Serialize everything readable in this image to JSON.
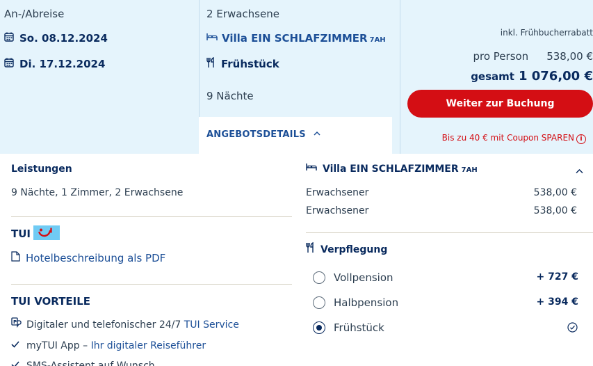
{
  "summary": {
    "dates_label": "An-/Abreise",
    "arrival": "So. 08.12.2024",
    "departure": "Di. 17.12.2024",
    "guests": "2 Erwachsene",
    "room_name": "Villa EIN SCHLAFZIMMER",
    "room_code": "7AH",
    "board": "Frühstück",
    "nights": "9 Nächte",
    "offer_details_tab": "ANGEBOTSDETAILS"
  },
  "pricing": {
    "rebate_note": "inkl. Frühbucherrabatt",
    "per_person_label": "pro Person",
    "per_person_value": "538,00 €",
    "total_label": "gesamt",
    "total_value": "1 076,00 €",
    "cta_label": "Weiter zur Buchung",
    "coupon_text": "Bis zu 40 € mit Coupon SPAREN",
    "coupon_info_icon": "i"
  },
  "services": {
    "title": "Leistungen",
    "text": "9 Nächte, 1 Zimmer, 2 Erwachsene"
  },
  "tui": {
    "title": "TUI",
    "logo_color": "#70cbf4",
    "pdf_link": "Hotelbeschreibung als PDF"
  },
  "benefits": {
    "title": "TUI VORTEILE",
    "items": [
      {
        "prefix": "Digitaler und telefonischer 24/7 ",
        "link": "TUI Service",
        "icon": "support-icon"
      },
      {
        "prefix": "myTUI App – ",
        "link": "Ihr digitaler Reiseführer",
        "icon": "check-icon"
      },
      {
        "prefix": "SMS-Assistent auf Wunsch",
        "link": "",
        "icon": "check-icon"
      }
    ]
  },
  "room_panel": {
    "room_name": "Villa EIN SCHLAFZIMMER",
    "room_code": "7AH",
    "lines": [
      {
        "label": "Erwachsener",
        "value": "538,00 €"
      },
      {
        "label": "Erwachsener",
        "value": "538,00 €"
      }
    ]
  },
  "meals": {
    "title": "Verpflegung",
    "options": [
      {
        "label": "Vollpension",
        "price": "+ 727 €",
        "selected": false
      },
      {
        "label": "Halbpension",
        "price": "+ 394 €",
        "selected": false
      },
      {
        "label": "Frühstück",
        "price": "",
        "selected": true
      }
    ]
  },
  "colors": {
    "brand_navy": "#092a5e",
    "brand_red": "#d40e14",
    "panel_bg": "#e5f4fc",
    "link_blue": "#1c4f97"
  }
}
